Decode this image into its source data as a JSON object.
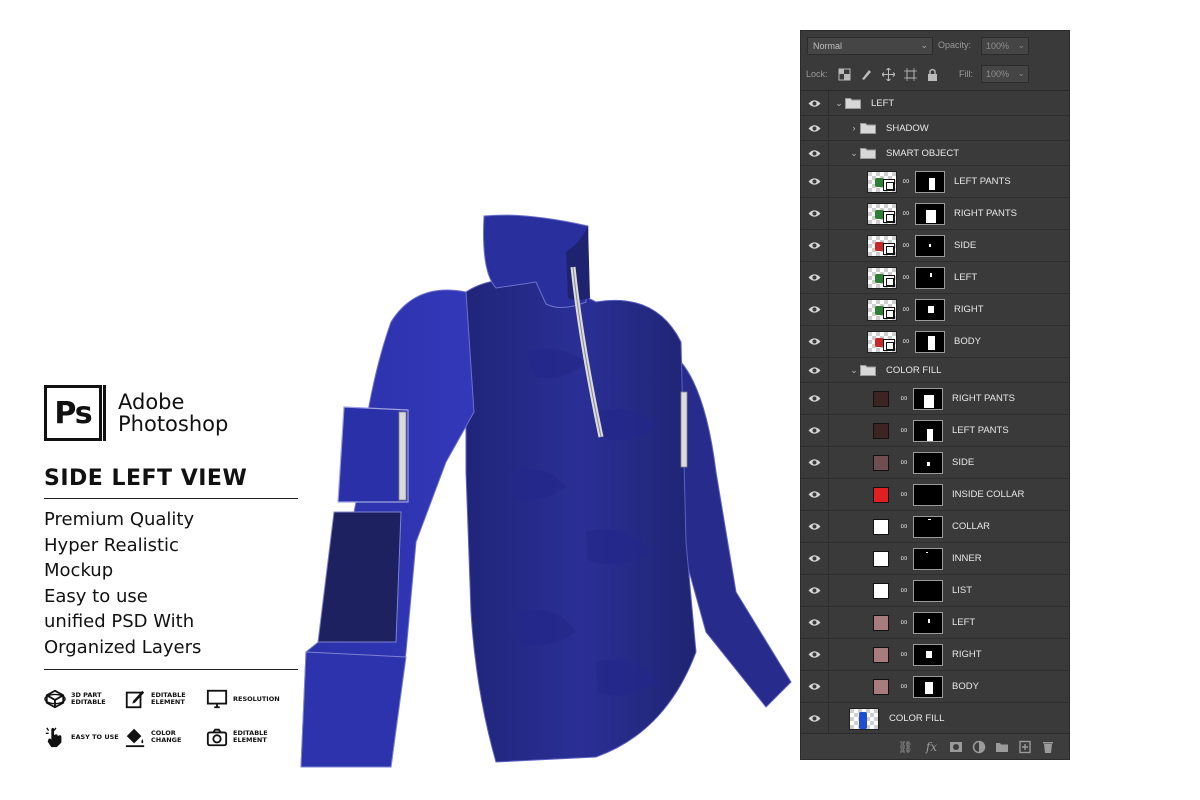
{
  "brand": {
    "logo_text": "Ps",
    "name_line1": "Adobe",
    "name_line2": "Photoshop"
  },
  "view_title": "SIDE LEFT VIEW",
  "features": [
    "Premium Quality",
    "Hyper Realistic",
    "Mockup",
    "Easy to use",
    "unified PSD With",
    "Organized Layers"
  ],
  "badges": [
    {
      "icon": "3d-cube-icon",
      "label": "3D PART EDITABLE"
    },
    {
      "icon": "edit-icon",
      "label": "EDITABLE ELEMENT"
    },
    {
      "icon": "monitor-icon",
      "label": "RESOLUTION"
    },
    {
      "icon": "click-hand-icon",
      "label": "EASY TO USE"
    },
    {
      "icon": "paint-bucket-icon",
      "label": "COLOR CHANGE"
    },
    {
      "icon": "camera-icon",
      "label": "EDITABLE ELEMENT"
    }
  ],
  "panel": {
    "blend_mode": "Normal",
    "opacity_label": "Opacity:",
    "opacity_value": "100%",
    "lock_label": "Lock:",
    "fill_label": "Fill:",
    "fill_value": "100%",
    "layers": [
      {
        "name": "LEFT",
        "kind": "group",
        "expanded": true,
        "indent": 0
      },
      {
        "name": "SHADOW",
        "kind": "group",
        "expanded": false,
        "indent": 1
      },
      {
        "name": "SMART OBJECT",
        "kind": "group",
        "expanded": true,
        "indent": 1
      },
      {
        "name": "LEFT PANTS",
        "kind": "smart",
        "blob": "#2e7d32"
      },
      {
        "name": "RIGHT PANTS",
        "kind": "smart",
        "blob": "#2e7d32"
      },
      {
        "name": "SIDE",
        "kind": "smart",
        "blob": "#c62828"
      },
      {
        "name": "LEFT",
        "kind": "smart",
        "blob": "#2e7d32"
      },
      {
        "name": "RIGHT",
        "kind": "smart",
        "blob": "#2e7d32"
      },
      {
        "name": "BODY",
        "kind": "smart",
        "blob": "#c62828"
      },
      {
        "name": "COLOR FILL",
        "kind": "group",
        "expanded": true,
        "indent": 1
      },
      {
        "name": "RIGHT PANTS",
        "kind": "fill",
        "color": "#3d2323"
      },
      {
        "name": "LEFT PANTS",
        "kind": "fill",
        "color": "#3d2323"
      },
      {
        "name": "SIDE",
        "kind": "fill",
        "color": "#6e4e52"
      },
      {
        "name": "INSIDE COLLAR",
        "kind": "fill",
        "color": "#e02020"
      },
      {
        "name": "COLLAR",
        "kind": "fill",
        "color": "#ffffff"
      },
      {
        "name": "INNER",
        "kind": "fill",
        "color": "#ffffff"
      },
      {
        "name": "LIST",
        "kind": "fill",
        "color": "#ffffff"
      },
      {
        "name": "LEFT",
        "kind": "fill",
        "color": "#a87c7c"
      },
      {
        "name": "RIGHT",
        "kind": "fill",
        "color": "#a87c7c"
      },
      {
        "name": "BODY",
        "kind": "fill",
        "color": "#a87c7c"
      },
      {
        "name": "COLOR FILL",
        "kind": "top-fill"
      }
    ]
  },
  "colors": {
    "jacket_main": "#2a2f9e",
    "jacket_dark": "#1e236f",
    "panel_bg": "#3a3a3a"
  }
}
